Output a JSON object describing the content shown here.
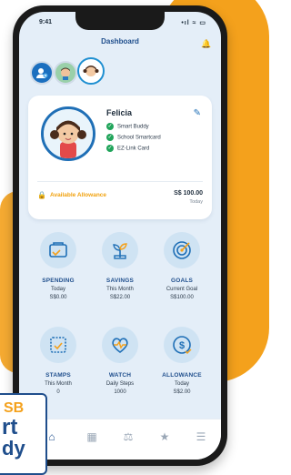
{
  "status": {
    "time": "9:41",
    "signal": "•ıl ≈ ▭"
  },
  "header": {
    "title": "Dashboard"
  },
  "profile": {
    "name": "Felicia",
    "features": [
      "Smart Buddy",
      "School Smartcard",
      "EZ-Link Card"
    ],
    "allowance_label": "Available Allowance",
    "allowance_amount": "S$ 100.00",
    "allowance_period": "Today"
  },
  "tiles": [
    {
      "label": "SPENDING",
      "line2": "Today",
      "line3": "S$0.00",
      "icon": "wallet-icon"
    },
    {
      "label": "SAVINGS",
      "line2": "This Month",
      "line3": "S$22.00",
      "icon": "plant-coin-icon"
    },
    {
      "label": "GOALS",
      "line2": "Current Goal",
      "line3": "S$100.00",
      "icon": "target-icon"
    },
    {
      "label": "STAMPS",
      "line2": "This Month",
      "line3": "0",
      "icon": "stamp-icon"
    },
    {
      "label": "WATCH",
      "line2": "Daily Steps",
      "line3": "1000",
      "icon": "heart-rate-icon"
    },
    {
      "label": "ALLOWANCE",
      "line2": "Today",
      "line3": "S$2.00",
      "icon": "dollar-icon"
    }
  ],
  "nav": [
    "home-icon",
    "book-icon",
    "transactions-icon",
    "star-icon",
    "menu-icon"
  ],
  "badge": {
    "line1": "SB",
    "line2": "rt",
    "line3": "dy"
  },
  "colors": {
    "primary": "#1f4e8c",
    "accent": "#f4a11c",
    "success": "#20a45a",
    "tile_bg": "#cfe3f3"
  }
}
